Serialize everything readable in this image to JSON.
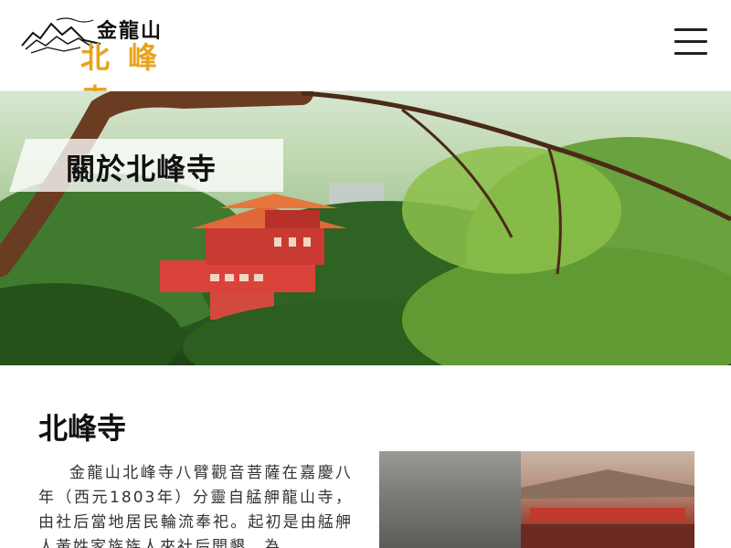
{
  "header": {
    "logo_small": "金龍山",
    "logo_big": "北峰寺",
    "menu_icon": "hamburger-menu-icon"
  },
  "hero": {
    "title": "關於北峰寺",
    "image": "temple-among-trees-photo"
  },
  "main": {
    "title": "北峰寺",
    "paragraph": "金龍山北峰寺八臂觀音菩薩在嘉慶八年（西元1803年）分靈自艋舺龍山寺，由社后當地居民輪流奉祀。起初是由艋舺人黃姓家族族人來社后開墾，為",
    "photo": "historic-temple-photo"
  },
  "colors": {
    "accent": "#e8a31c",
    "text": "#222222"
  }
}
